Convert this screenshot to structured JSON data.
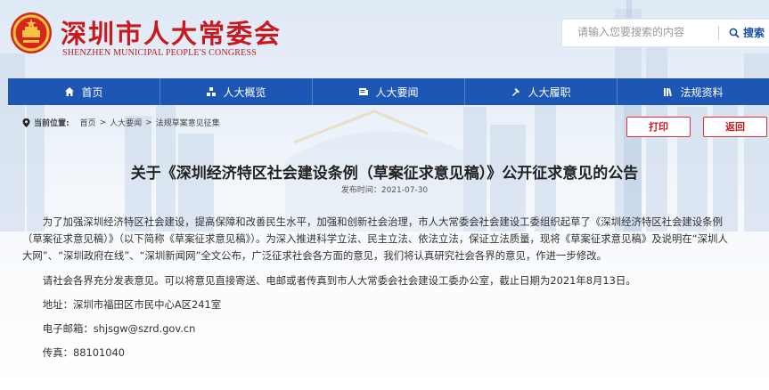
{
  "header": {
    "title_cn": "深圳市人大常委会",
    "title_en": "SHENZHEN MUNICIPAL PEOPLE'S CONGRESS",
    "search_placeholder": "请输入您要搜索的内容",
    "search_button": "搜索"
  },
  "nav": [
    {
      "label": "首页",
      "icon": "home-icon"
    },
    {
      "label": "人大概览",
      "icon": "overview-icon"
    },
    {
      "label": "人大要闻",
      "icon": "news-icon"
    },
    {
      "label": "人大履职",
      "icon": "duty-icon"
    },
    {
      "label": "法规资料",
      "icon": "books-icon"
    }
  ],
  "breadcrumb": {
    "label": "当前位置:",
    "items": [
      "首页",
      "人大要闻",
      "法规草案意见征集"
    ],
    "sep": ">"
  },
  "actions": {
    "print": "打印",
    "back": "返回"
  },
  "article": {
    "title": "关于《深圳经济特区社会建设条例（草案征求意见稿）》公开征求意见的公告",
    "published": "发布时间：2021-07-30",
    "paragraphs": [
      "为了加强深圳经济特区社会建设，提高保障和改善民生水平，加强和创新社会治理，市人大常委会社会建设工委组织起草了《深圳经济特区社会建设条例（草案征求意见稿）》（以下简称《草案征求意见稿》）。为深入推进科学立法、民主立法、依法立法，保证立法质量，现将《草案征求意见稿》及说明在“深圳人大网”、“深圳政府在线”、“深圳新闻网”全文公布，广泛征求社会各方面的意见，我们将认真研究社会各界的意见，作进一步修改。",
      "请社会各界充分发表意见。可以将意见直接寄送、电邮或者传真到市人大常委会社会建设工委办公室，截止日期为2021年8月13日。",
      "地址：深圳市福田区市民中心A区241室",
      "电子邮箱：shjsgw@szrd.gov.cn",
      "传真：88101040"
    ]
  },
  "colors": {
    "brand_red": "#c8191f",
    "nav_blue": "#1e56b3"
  }
}
